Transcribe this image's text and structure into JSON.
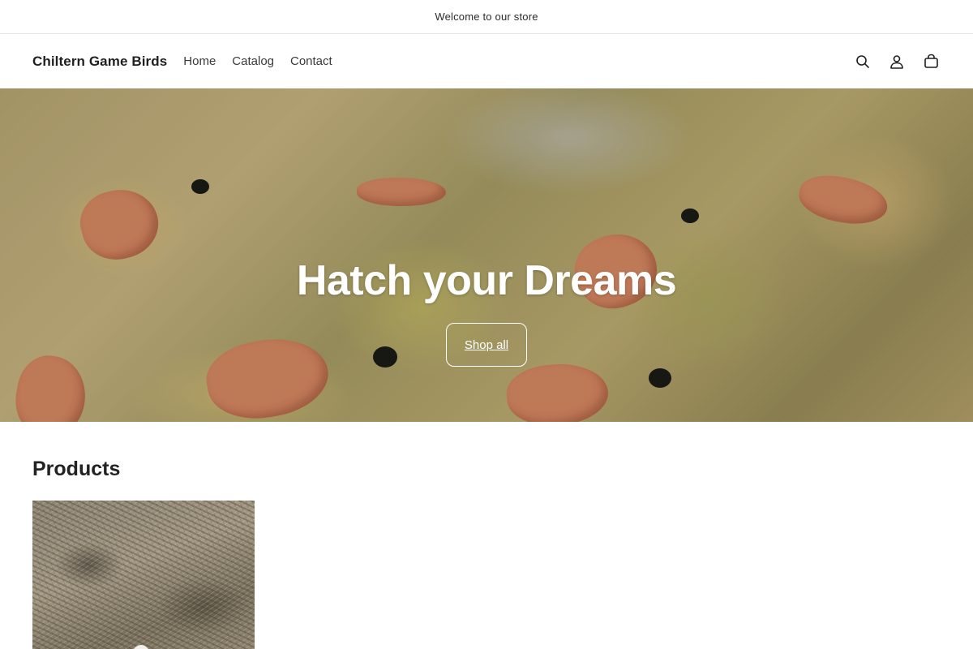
{
  "announcement": {
    "text": "Welcome to our store"
  },
  "header": {
    "logo": "Chiltern Game Birds",
    "nav": [
      {
        "label": "Home"
      },
      {
        "label": "Catalog"
      },
      {
        "label": "Contact"
      }
    ],
    "icons": [
      "search-icon",
      "account-icon",
      "cart-icon"
    ]
  },
  "hero": {
    "title": "Hatch your Dreams",
    "button_label": "Shop all"
  },
  "products": {
    "title": "Products"
  }
}
